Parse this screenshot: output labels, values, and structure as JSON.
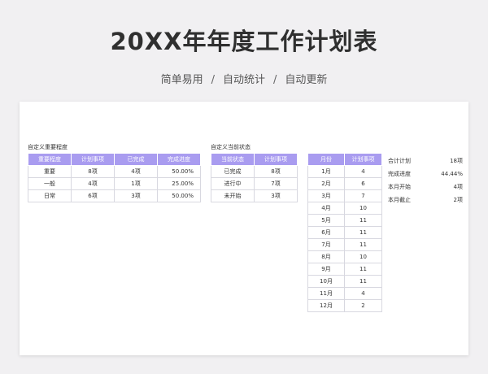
{
  "header": {
    "title": "20XX年年度工作计划表",
    "subtitle_parts": [
      "简单易用",
      "自动统计",
      "自动更新"
    ],
    "separator": "/"
  },
  "importance_table": {
    "label": "自定义重要程度",
    "columns": [
      "重要程度",
      "计划事项",
      "已完成",
      "完成进度"
    ],
    "rows": [
      [
        "重要",
        "8项",
        "4项",
        "50.00%"
      ],
      [
        "一般",
        "4项",
        "1项",
        "25.00%"
      ],
      [
        "日常",
        "6项",
        "3项",
        "50.00%"
      ]
    ]
  },
  "status_table": {
    "label": "自定义当前状态",
    "columns": [
      "当前状态",
      "计划事项"
    ],
    "rows": [
      [
        "已完成",
        "8项"
      ],
      [
        "进行中",
        "7项"
      ],
      [
        "未开始",
        "3项"
      ]
    ]
  },
  "month_table": {
    "columns": [
      "月份",
      "计划事项"
    ],
    "rows": [
      [
        "1月",
        "4"
      ],
      [
        "2月",
        "6"
      ],
      [
        "3月",
        "7"
      ],
      [
        "4月",
        "10"
      ],
      [
        "5月",
        "11"
      ],
      [
        "6月",
        "11"
      ],
      [
        "7月",
        "11"
      ],
      [
        "8月",
        "10"
      ],
      [
        "9月",
        "11"
      ],
      [
        "10月",
        "11"
      ],
      [
        "11月",
        "4"
      ],
      [
        "12月",
        "2"
      ]
    ]
  },
  "summary": [
    {
      "label": "合计计划",
      "value": "18项"
    },
    {
      "label": "完成进度",
      "value": "44.44%"
    },
    {
      "label": "本月开始",
      "value": "4项"
    },
    {
      "label": "本月截止",
      "value": "2项"
    }
  ],
  "colors": {
    "header_fill": "#a99cf0",
    "background": "#f1f0f2"
  }
}
